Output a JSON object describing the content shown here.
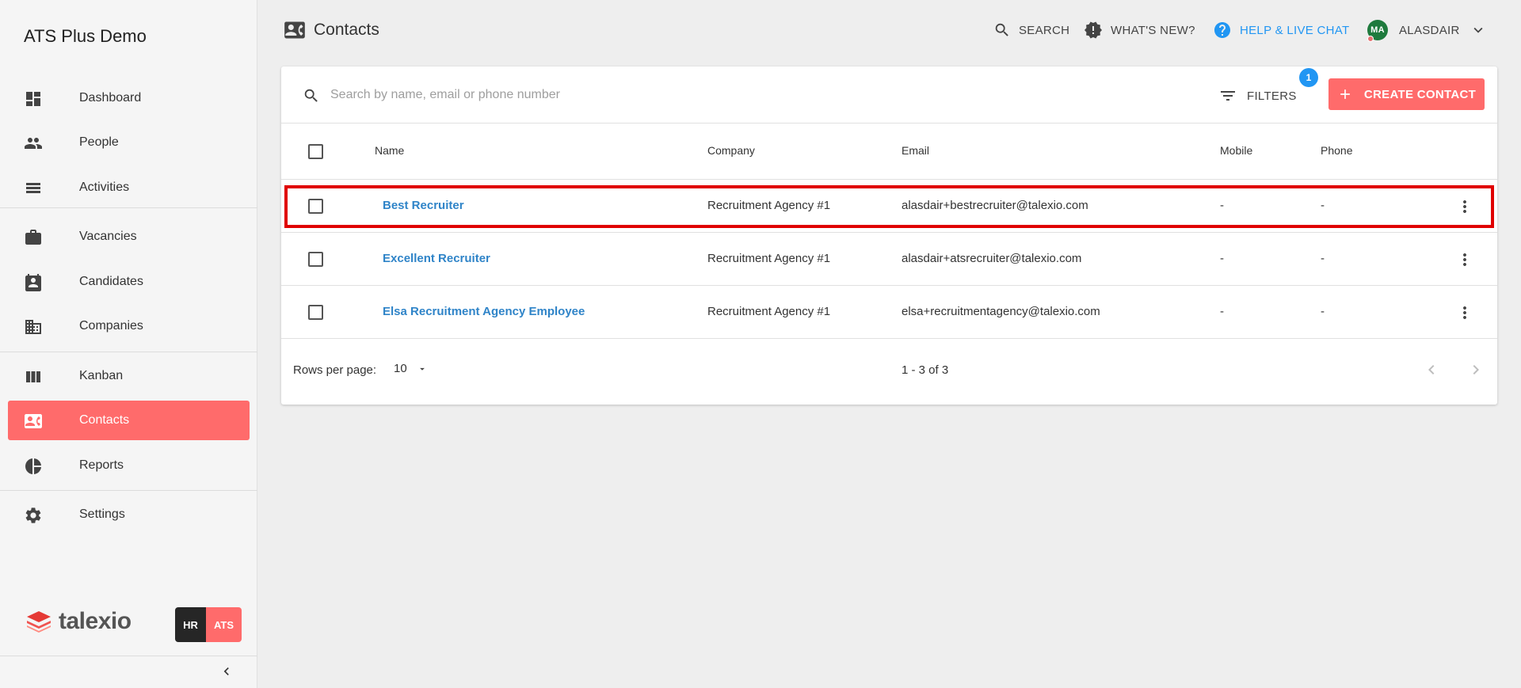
{
  "app": {
    "title": "ATS Plus Demo"
  },
  "sidebar": {
    "items": [
      {
        "label": "Dashboard",
        "icon": "dashboard-icon"
      },
      {
        "label": "People",
        "icon": "people-icon"
      },
      {
        "label": "Activities",
        "icon": "activities-icon"
      },
      {
        "label": "Vacancies",
        "icon": "briefcase-icon"
      },
      {
        "label": "Candidates",
        "icon": "candidate-card-icon"
      },
      {
        "label": "Companies",
        "icon": "building-icon"
      },
      {
        "label": "Kanban",
        "icon": "kanban-icon"
      },
      {
        "label": "Contacts",
        "icon": "contact-card-icon",
        "active": true
      },
      {
        "label": "Reports",
        "icon": "pie-chart-icon"
      },
      {
        "label": "Settings",
        "icon": "gear-icon"
      }
    ],
    "brand": "talexio",
    "badge_hr": "HR",
    "badge_ats": "ATS"
  },
  "header": {
    "title": "Contacts",
    "search_label": "SEARCH",
    "whats_new_label": "WHAT'S NEW?",
    "help_label": "HELP & LIVE CHAT",
    "user_initials": "MA",
    "user_name": "ALASDAIR"
  },
  "toolbar": {
    "search_placeholder": "Search by name, email or phone number",
    "filters_label": "FILTERS",
    "filters_count": "1",
    "create_label": "CREATE CONTACT"
  },
  "table": {
    "columns": {
      "name": "Name",
      "company": "Company",
      "email": "Email",
      "mobile": "Mobile",
      "phone": "Phone"
    },
    "rows": [
      {
        "name": "Best Recruiter",
        "company": "Recruitment Agency #1",
        "email": "alasdair+bestrecruiter@talexio.com",
        "mobile": "-",
        "phone": "-"
      },
      {
        "name": "Excellent Recruiter",
        "company": "Recruitment Agency #1",
        "email": "alasdair+atsrecruiter@talexio.com",
        "mobile": "-",
        "phone": "-"
      },
      {
        "name": "Elsa Recruitment Agency Employee",
        "company": "Recruitment Agency #1",
        "email": "elsa+recruitmentagency@talexio.com",
        "mobile": "-",
        "phone": "-"
      }
    ]
  },
  "pagination": {
    "rows_per_page_label": "Rows per page:",
    "rows_per_page": "10",
    "range": "1 - 3 of 3"
  },
  "colors": {
    "accent": "#ff6b6b",
    "link": "#2f84c8",
    "help": "#2196f3",
    "highlight": "#e00000"
  }
}
